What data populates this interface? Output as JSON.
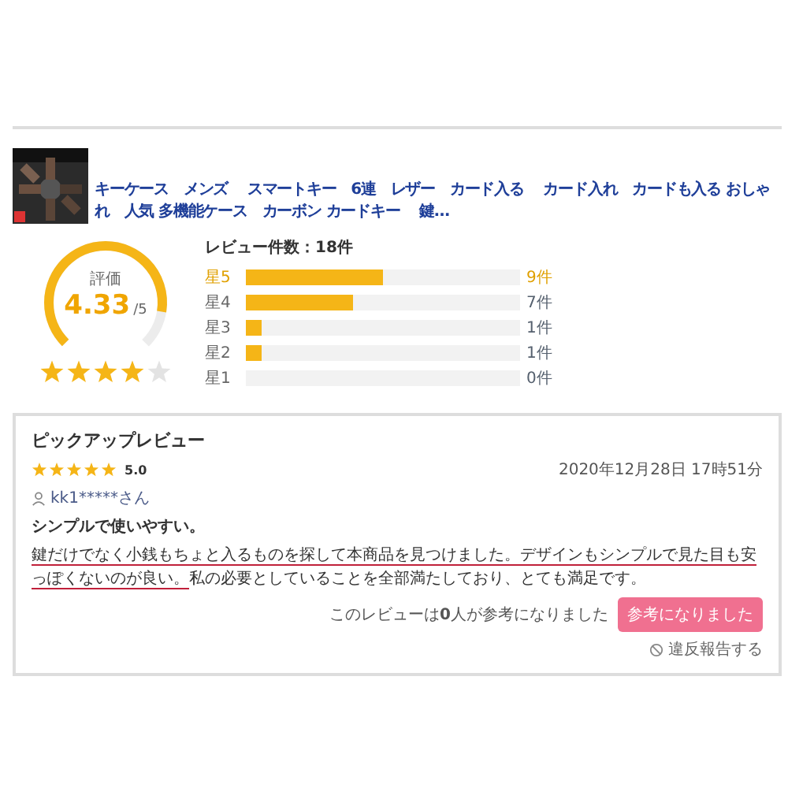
{
  "product": {
    "title": "キーケース　メンズ　 スマートキー　6連　レザー　カード入る　 カード入れ　カードも入る おしゃれ　人気 多機能ケース　カーボン カードキー　 鍵…"
  },
  "summary": {
    "label": "評価",
    "score": "4.33",
    "out_of": "/5",
    "stars": 4
  },
  "distribution": {
    "title": "レビュー件数：18件",
    "rows": [
      {
        "label": "星5",
        "level": 0.5,
        "count": "9件",
        "selected": true
      },
      {
        "label": "星4",
        "level": 0.389,
        "count": "7件",
        "selected": false
      },
      {
        "label": "星3",
        "level": 0.056,
        "count": "1件",
        "selected": false
      },
      {
        "label": "星2",
        "level": 0.056,
        "count": "1件",
        "selected": false
      },
      {
        "label": "星1",
        "count": "0件",
        "selected": false
      }
    ]
  },
  "pickup": {
    "heading": "ピックアップレビュー",
    "stars": 5,
    "rating": "5.0",
    "date": "2020年12月28日 17時51分",
    "reviewer": "kk1*****さん",
    "review_title": "シンプルで使いやすい。",
    "underlined_text": "鍵だけでなく小銭もちょと入るものを探して本商品を見つけました。デザインもシンプルで見た目も安っぽくないのが良い。",
    "body_rest": "私の必要としていることを全部満たしており、とても満足です。",
    "helpful_before": "このレビューは",
    "helpful_count": "0",
    "helpful_after": "人が参考になりました",
    "helpful_button": "参考になりました",
    "report_link": "違反報告する"
  }
}
